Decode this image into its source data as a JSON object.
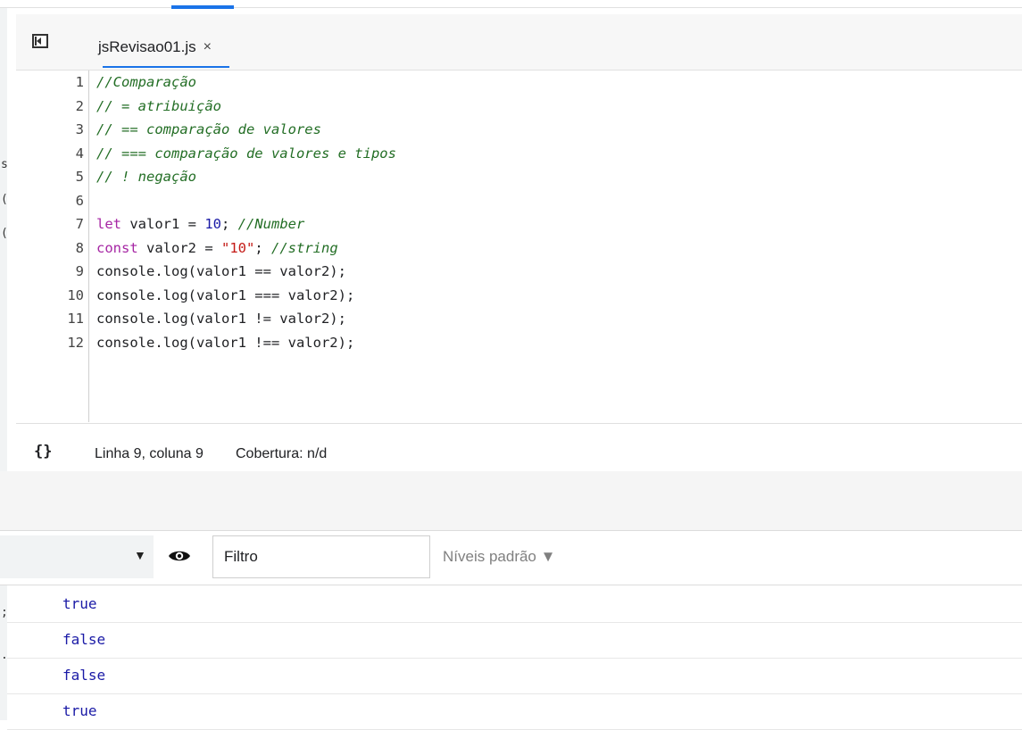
{
  "left_panel": {
    "fragments": [
      "s",
      "(",
      "(",
      ";",
      ".."
    ]
  },
  "editor": {
    "tab": {
      "file_name": "jsRevisao01.js",
      "close_glyph": "×"
    },
    "lines": [
      {
        "n": "1",
        "segments": [
          {
            "c": "cm",
            "t": "//Comparação"
          }
        ]
      },
      {
        "n": "2",
        "segments": [
          {
            "c": "cm",
            "t": "// = atribuição"
          }
        ]
      },
      {
        "n": "3",
        "segments": [
          {
            "c": "cm",
            "t": "// == comparação de valores"
          }
        ]
      },
      {
        "n": "4",
        "segments": [
          {
            "c": "cm",
            "t": "// === comparação de valores e tipos"
          }
        ]
      },
      {
        "n": "5",
        "segments": [
          {
            "c": "cm",
            "t": "// ! negação"
          }
        ]
      },
      {
        "n": "6",
        "segments": []
      },
      {
        "n": "7",
        "segments": [
          {
            "c": "kw",
            "t": "let "
          },
          {
            "c": "tx",
            "t": "valor1 = "
          },
          {
            "c": "num",
            "t": "10"
          },
          {
            "c": "tx",
            "t": "; "
          },
          {
            "c": "cm",
            "t": "//Number"
          }
        ]
      },
      {
        "n": "8",
        "segments": [
          {
            "c": "kw",
            "t": "const "
          },
          {
            "c": "tx",
            "t": "valor2 = "
          },
          {
            "c": "str",
            "t": "\"10\""
          },
          {
            "c": "tx",
            "t": "; "
          },
          {
            "c": "cm",
            "t": "//string"
          }
        ]
      },
      {
        "n": "9",
        "segments": [
          {
            "c": "tx",
            "t": "console.log(valor1 == valor2);"
          }
        ]
      },
      {
        "n": "10",
        "segments": [
          {
            "c": "tx",
            "t": "console.log(valor1 === valor2);"
          }
        ]
      },
      {
        "n": "11",
        "segments": [
          {
            "c": "tx",
            "t": "console.log(valor1 != valor2);"
          }
        ]
      },
      {
        "n": "12",
        "segments": [
          {
            "c": "tx",
            "t": "console.log(valor1 !== valor2);"
          }
        ]
      }
    ]
  },
  "status": {
    "pretty_print_glyph": "{}",
    "cursor_position": "Linha 9, coluna 9",
    "coverage": "Cobertura: n/d"
  },
  "console": {
    "context_arrow": "▼",
    "filter_placeholder": "Filtro",
    "levels_label": "Níveis padrão ▼",
    "outputs": [
      "true",
      "false",
      "false",
      "true"
    ]
  },
  "colors": {
    "accent": "#1a73e8",
    "comment": "#236e25",
    "keyword": "#a626a4",
    "number": "#1a1aa6",
    "string": "#c41a16",
    "console_value": "#1a1aa6"
  },
  "icons": [
    "toggle-navigator-icon",
    "close-icon",
    "pretty-print-icon",
    "dropdown-arrow-icon",
    "eye-icon"
  ]
}
